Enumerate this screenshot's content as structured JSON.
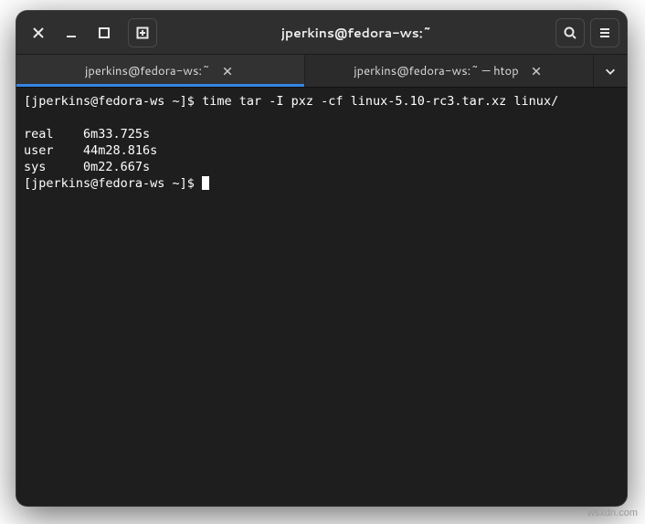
{
  "window": {
    "title": "jperkins@fedora-ws:~"
  },
  "titlebar": {
    "close_icon": "close",
    "minimize_icon": "minimize",
    "maximize_icon": "maximize",
    "newtab_icon": "new-tab",
    "search_icon": "search",
    "menu_icon": "menu"
  },
  "tabs": [
    {
      "label": "jperkins@fedora-ws:~",
      "active": true
    },
    {
      "label": "jperkins@fedora-ws:~ — htop",
      "active": false
    }
  ],
  "terminal": {
    "lines": [
      "[jperkins@fedora-ws ~]$ time tar -I pxz -cf linux-5.10-rc3.tar.xz linux/",
      "",
      "real    6m33.725s",
      "user    44m28.816s",
      "sys     0m22.667s"
    ],
    "prompt": "[jperkins@fedora-ws ~]$ "
  },
  "watermark": "wsxdn.com"
}
